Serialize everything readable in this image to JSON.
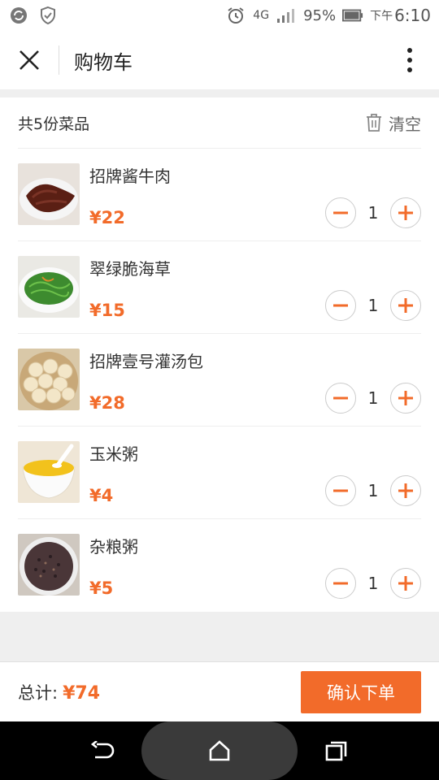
{
  "status_bar": {
    "battery": "95%",
    "network": "4G",
    "time_prefix": "下午",
    "time": "6:10"
  },
  "header": {
    "title": "购物车"
  },
  "cart": {
    "count_label": "共5份菜品",
    "clear_label": "清空",
    "items": [
      {
        "name": "招牌酱牛肉",
        "price": "¥22",
        "qty": "1"
      },
      {
        "name": "翠绿脆海草",
        "price": "¥15",
        "qty": "1"
      },
      {
        "name": "招牌壹号灌汤包",
        "price": "¥28",
        "qty": "1"
      },
      {
        "name": "玉米粥",
        "price": "¥4",
        "qty": "1"
      },
      {
        "name": "杂粮粥",
        "price": "¥5",
        "qty": "1"
      }
    ]
  },
  "footer": {
    "total_label": "总计:",
    "total_value": "¥74",
    "confirm_label": "确认下单"
  },
  "colors": {
    "accent": "#f26b2a"
  }
}
